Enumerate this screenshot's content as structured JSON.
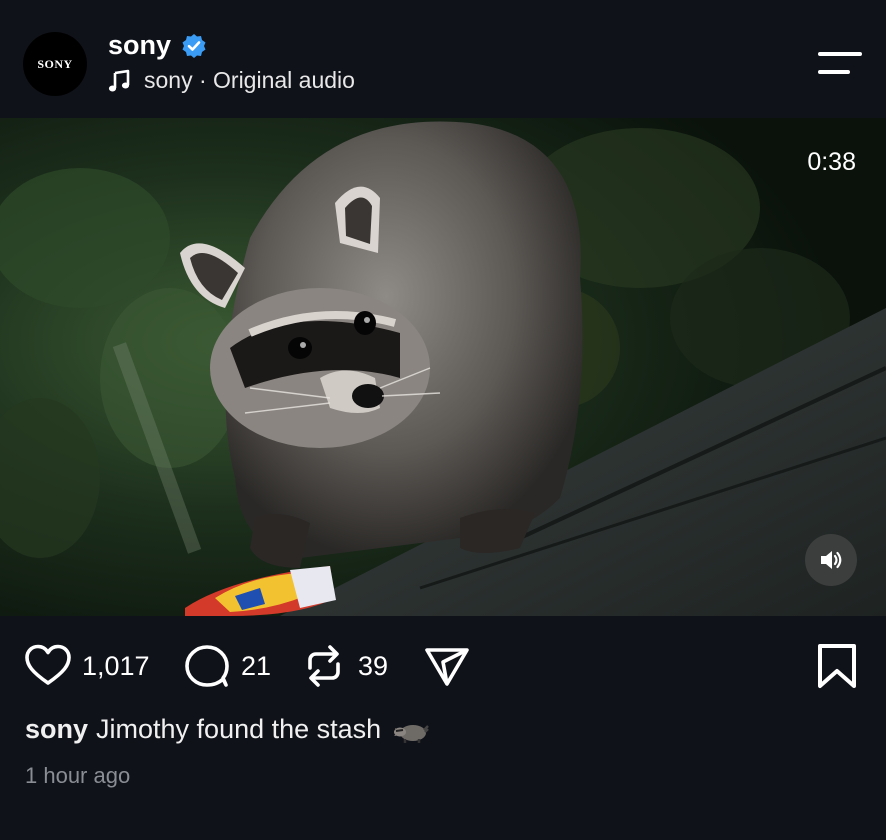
{
  "post": {
    "account": {
      "username": "sony",
      "avatar_text": "SONY",
      "verified": true
    },
    "audio": {
      "icon": "music-note-icon",
      "text": "sony · Original audio"
    },
    "media": {
      "duration": "0:38",
      "muted_state": "sound-on"
    },
    "actions": {
      "likes": "1,017",
      "comments": "21",
      "reposts": "39"
    },
    "caption": {
      "username": "sony",
      "text": "Jimothy found the stash",
      "emoji": "raccoon-emoji"
    },
    "timestamp": "1 hour ago"
  },
  "colors": {
    "background": "#10121a",
    "verified_badge": "#3b9cf5",
    "text_primary": "#ffffff",
    "text_secondary": "#8a8d94"
  }
}
